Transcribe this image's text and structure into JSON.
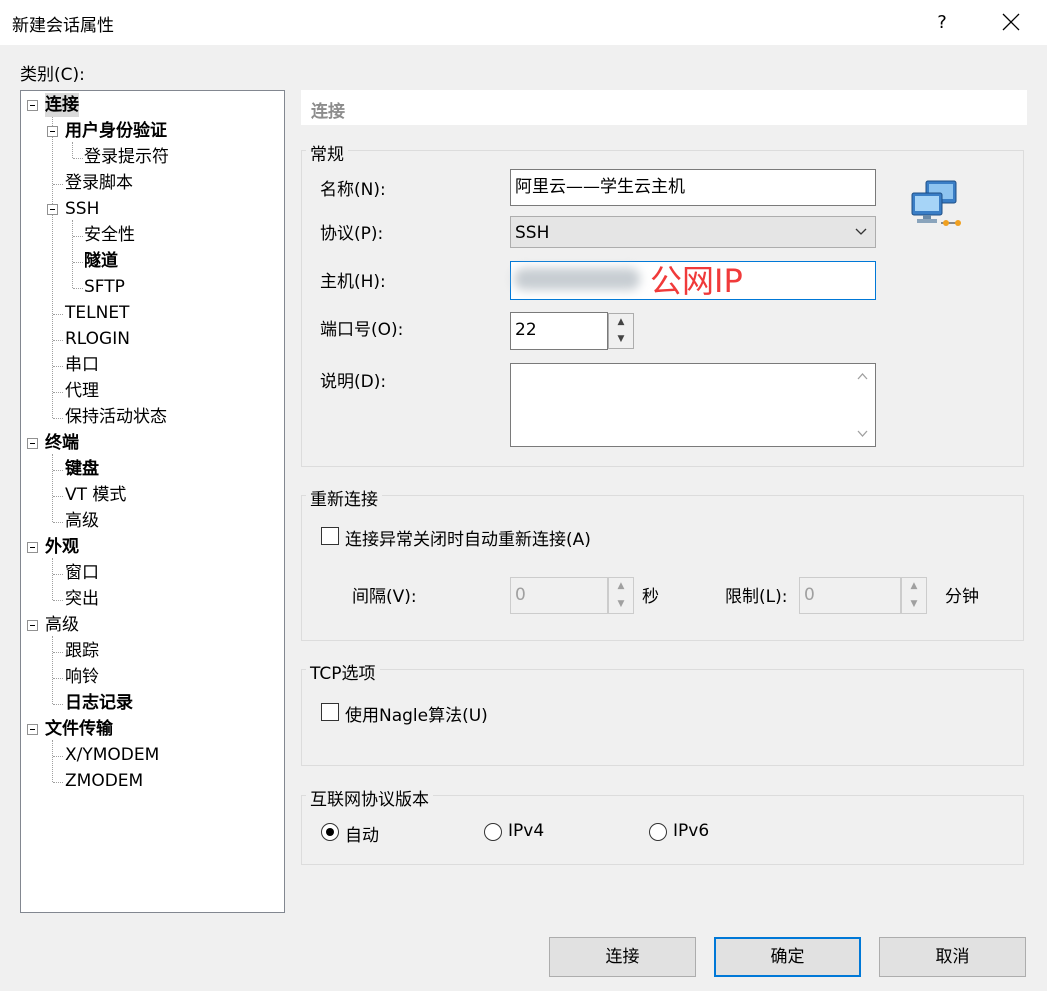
{
  "window": {
    "title": "新建会话属性",
    "help": "?",
    "close_icon": "close-icon"
  },
  "category_label": "类别(C):",
  "tree": [
    {
      "label": "连接",
      "bold": true
    },
    {
      "label": "用户身份验证",
      "bold": true
    },
    {
      "label": "登录提示符",
      "bold": false
    },
    {
      "label": "登录脚本",
      "bold": false
    },
    {
      "label": "SSH",
      "bold": false
    },
    {
      "label": "安全性",
      "bold": false
    },
    {
      "label": "隧道",
      "bold": true
    },
    {
      "label": "SFTP",
      "bold": false
    },
    {
      "label": "TELNET",
      "bold": false
    },
    {
      "label": "RLOGIN",
      "bold": false
    },
    {
      "label": "串口",
      "bold": false
    },
    {
      "label": "代理",
      "bold": false
    },
    {
      "label": "保持活动状态",
      "bold": false
    },
    {
      "label": "终端",
      "bold": true
    },
    {
      "label": "键盘",
      "bold": true
    },
    {
      "label": "VT 模式",
      "bold": false
    },
    {
      "label": "高级",
      "bold": false
    },
    {
      "label": "外观",
      "bold": true
    },
    {
      "label": "窗口",
      "bold": false
    },
    {
      "label": "突出",
      "bold": false
    },
    {
      "label": "高级",
      "bold": false
    },
    {
      "label": "跟踪",
      "bold": false
    },
    {
      "label": "响铃",
      "bold": false
    },
    {
      "label": "日志记录",
      "bold": true
    },
    {
      "label": "文件传输",
      "bold": true
    },
    {
      "label": "X/YMODEM",
      "bold": false
    },
    {
      "label": "ZMODEM",
      "bold": false
    }
  ],
  "panel": {
    "header": "连接",
    "general": {
      "title": "常规",
      "name_label": "名称(N):",
      "name_value": "阿里云——学生云主机",
      "protocol_label": "协议(P):",
      "protocol_value": "SSH",
      "host_label": "主机(H):",
      "host_value": "",
      "host_annotation": "公网IP",
      "port_label": "端口号(O):",
      "port_value": "22",
      "desc_label": "说明(D):",
      "desc_value": ""
    },
    "reconnect": {
      "title": "重新连接",
      "checkbox_label": "连接异常关闭时自动重新连接(A)",
      "checked": false,
      "interval_label": "间隔(V):",
      "interval_value": "0",
      "interval_unit": "秒",
      "limit_label": "限制(L):",
      "limit_value": "0",
      "limit_unit": "分钟"
    },
    "tcp": {
      "title": "TCP选项",
      "nagle_label": "使用Nagle算法(U)",
      "checked": false
    },
    "ip_version": {
      "title": "互联网协议版本",
      "options": [
        "自动",
        "IPv4",
        "IPv6"
      ],
      "selected": "自动"
    }
  },
  "buttons": {
    "connect": "连接",
    "ok": "确定",
    "cancel": "取消"
  }
}
